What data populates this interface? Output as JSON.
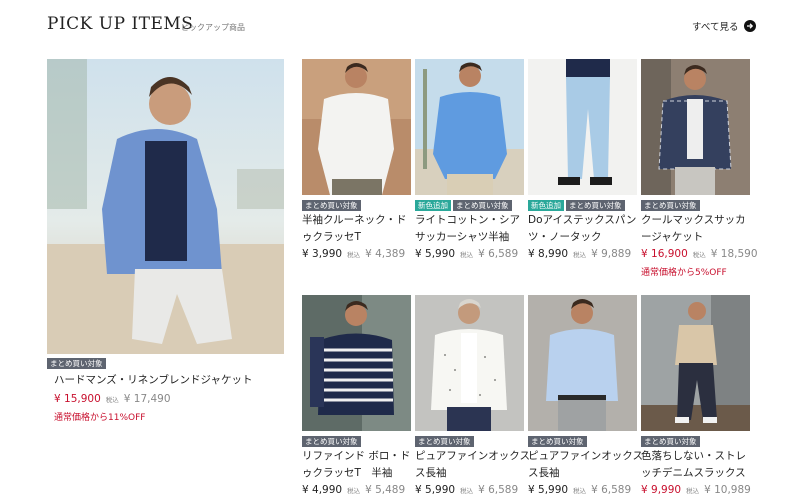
{
  "header": {
    "title": "PICK UP ITEMS",
    "subtitle": "ピックアップ商品",
    "see_all": "すべて見る"
  },
  "featured": {
    "badge": "まとめ買い対象",
    "name": "ハードマンズ・リネンブレンドジャケット",
    "price": "¥ 15,900",
    "tax_label": "税込",
    "orig_price": "¥ 17,490",
    "discount": "通常価格から11%OFF"
  },
  "items": [
    {
      "badges": [
        "まとめ買い対象"
      ],
      "name_line1": "半袖クルーネック・ド",
      "name_line2": "ゥクラッセT",
      "price": "¥ 3,990",
      "tax_label": "税込",
      "orig_price": "¥ 4,389"
    },
    {
      "badges": [
        "新色追加",
        "まとめ買い対象"
      ],
      "name_line1": "ライトコットン・シア",
      "name_line2": "サッカーシャツ半袖",
      "price": "¥ 5,990",
      "tax_label": "税込",
      "orig_price": "¥ 6,589"
    },
    {
      "badges": [
        "新色追加",
        "まとめ買い対象"
      ],
      "name_line1": "Doアイステックスパン",
      "name_line2": "ツ・ノータック",
      "price": "¥ 8,990",
      "tax_label": "税込",
      "orig_price": "¥ 9,889"
    },
    {
      "badges": [
        "まとめ買い対象"
      ],
      "name_line1": "クールマックスサッカ",
      "name_line2": "ージャケット",
      "price": "¥ 16,900",
      "tax_label": "税込",
      "orig_price": "¥ 18,590",
      "discount": "通常価格から5%OFF"
    },
    {
      "badges": [
        "まとめ買い対象"
      ],
      "name_line1": "リファインド ボロ・ド",
      "name_line2": "ゥクラッセT　半袖",
      "price": "¥ 4,990",
      "tax_label": "税込",
      "orig_price": "¥ 5,489"
    },
    {
      "badges": [
        "まとめ買い対象"
      ],
      "name_line1": "ピュアファインオックス",
      "name_line2": "ス長袖",
      "price": "¥ 5,990",
      "tax_label": "税込",
      "orig_price": "¥ 6,589"
    },
    {
      "badges": [
        "まとめ買い対象"
      ],
      "name_line1": "ピュアファインオックス",
      "name_line2": "ス長袖",
      "price": "¥ 5,990",
      "tax_label": "税込",
      "orig_price": "¥ 6,589"
    },
    {
      "badges": [
        "まとめ買い対象"
      ],
      "name_line1": "色落ちしない・ストレ",
      "name_line2": "ッチデニムスラックス",
      "price": "¥ 9,990",
      "tax_label": "税込",
      "orig_price": "¥ 10,989"
    }
  ],
  "colors": {
    "sale": "#c8102e",
    "badge_gray": "#5e6470",
    "badge_teal": "#2aa89a"
  }
}
